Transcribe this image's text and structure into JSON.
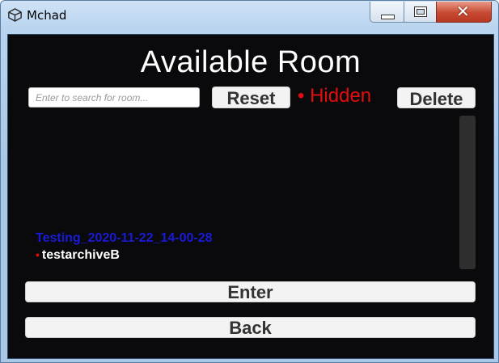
{
  "window": {
    "title": "Mchad",
    "close_glyph": "✕"
  },
  "main": {
    "heading": "Available Room",
    "search": {
      "placeholder": "Enter to search for room..."
    },
    "reset_label": "Reset",
    "hidden_toggle": {
      "bullet": "•",
      "label": "Hidden",
      "color": "#e40d0d"
    },
    "delete_label": "Delete",
    "rooms": [
      {
        "name": "Testing_2020-11-22_14-00-28",
        "bullet": "",
        "color": "#1a1ad6"
      },
      {
        "name": "testarchiveB",
        "bullet": "•",
        "color": "#ffffff"
      }
    ],
    "enter_label": "Enter",
    "back_label": "Back"
  }
}
